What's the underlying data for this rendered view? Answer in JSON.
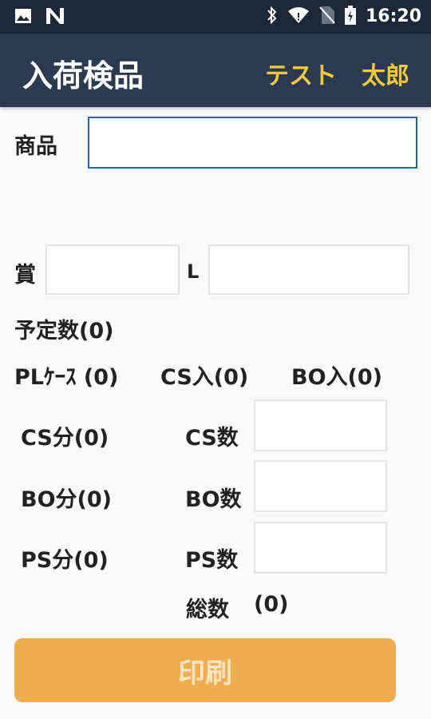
{
  "status_bar": {
    "time": "16:20",
    "icons": [
      "image-icon",
      "notification-n-icon",
      "bluetooth-icon",
      "wifi-icon",
      "no-sim-icon",
      "battery-icon"
    ]
  },
  "header": {
    "title": "入荷検品",
    "user_first": "テスト",
    "user_last": "太郎"
  },
  "form": {
    "product_label": "商品",
    "product_value": "",
    "expiry_label": "賞",
    "expiry_value": "",
    "lot_label": "L",
    "lot_value": "",
    "planned_qty": "予定数(0)",
    "pl_case": "PLｹｰｽ (0)",
    "cs_in": "CS入(0)",
    "bo_in": "BO入(0)",
    "cs_part": "CS分(0)",
    "bo_part": "BO分(0)",
    "ps_part": "PS分(0)",
    "cs_qty_label": "CS数",
    "bo_qty_label": "BO数",
    "ps_qty_label": "PS数",
    "cs_qty_value": "",
    "bo_qty_value": "",
    "ps_qty_value": "",
    "total_label": "総数",
    "total_value": "(0)"
  },
  "actions": {
    "print_label": "印刷"
  },
  "colors": {
    "status_bar": "#1c2838",
    "app_bar": "#2a3a4f",
    "user_name": "#f4c73e",
    "focus_border": "#1565c0",
    "print_button": "#efad4d"
  }
}
